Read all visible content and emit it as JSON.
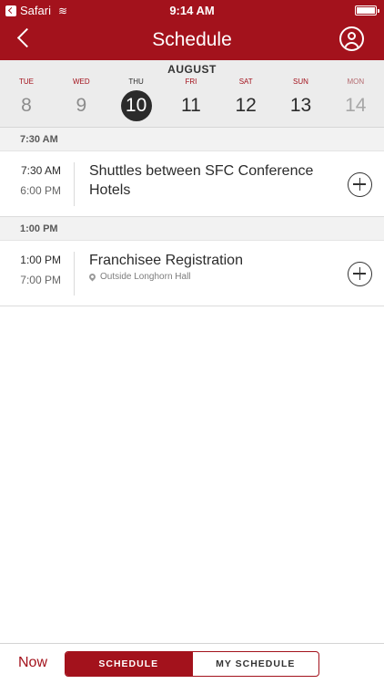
{
  "status_bar": {
    "back_app": "Safari",
    "time": "9:14 AM"
  },
  "nav": {
    "title": "Schedule"
  },
  "week": {
    "month": "AUGUST",
    "days": [
      {
        "dow": "TUE",
        "num": "8",
        "state": "past"
      },
      {
        "dow": "WED",
        "num": "9",
        "state": "past"
      },
      {
        "dow": "THU",
        "num": "10",
        "state": "selected"
      },
      {
        "dow": "FRI",
        "num": "11",
        "state": "normal"
      },
      {
        "dow": "SAT",
        "num": "12",
        "state": "normal"
      },
      {
        "dow": "SUN",
        "num": "13",
        "state": "normal"
      },
      {
        "dow": "MON",
        "num": "14",
        "state": "dim"
      }
    ]
  },
  "sections": [
    {
      "header": "7:30 AM",
      "events": [
        {
          "start": "7:30 AM",
          "end": "6:00 PM",
          "title": "Shuttles between SFC Conference Hotels",
          "location": ""
        }
      ]
    },
    {
      "header": "1:00 PM",
      "events": [
        {
          "start": "1:00 PM",
          "end": "7:00 PM",
          "title": "Franchisee Registration",
          "location": "Outside Longhorn Hall"
        }
      ]
    }
  ],
  "bottom": {
    "now_label": "Now",
    "tab_schedule": "SCHEDULE",
    "tab_my_schedule": "MY SCHEDULE"
  },
  "colors": {
    "accent": "#a3121c",
    "selected_day": "#2b2b2b"
  }
}
